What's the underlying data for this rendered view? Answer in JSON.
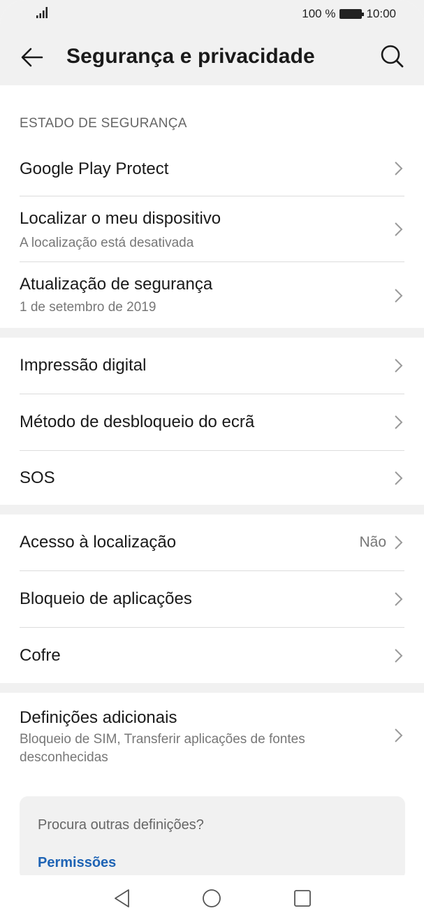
{
  "status_bar": {
    "battery_text": "100 %",
    "time": "10:00"
  },
  "header": {
    "title": "Segurança e privacidade",
    "back_icon": "arrow-left-icon",
    "search_icon": "search-icon"
  },
  "sections": {
    "security_status_label": "ESTADO DE SEGURANÇA"
  },
  "items": {
    "play_protect": {
      "label": "Google Play Protect"
    },
    "find_device": {
      "label": "Localizar o meu dispositivo",
      "sub": "A localização está desativada"
    },
    "security_update": {
      "label": "Atualização de segurança",
      "sub": "1 de setembro de 2019"
    },
    "fingerprint": {
      "label": "Impressão digital"
    },
    "screen_unlock": {
      "label": "Método de desbloqueio do ecrã"
    },
    "sos": {
      "label": "SOS"
    },
    "location_access": {
      "label": "Acesso à localização",
      "value": "Não"
    },
    "app_lock": {
      "label": "Bloqueio de aplicações"
    },
    "safe": {
      "label": "Cofre"
    },
    "additional": {
      "label": "Definições adicionais",
      "sub_line1": "Bloqueio de SIM, Transferir aplicações de fontes",
      "sub_line2": "desconhecidas"
    }
  },
  "suggestion_card": {
    "question": "Procura outras definições?",
    "link": "Permissões"
  },
  "nav_bar": {
    "back": "triangle-back-icon",
    "home": "circle-home-icon",
    "recents": "square-recents-icon"
  },
  "colors": {
    "background": "#f1f1f1",
    "link": "#1f64b5"
  }
}
